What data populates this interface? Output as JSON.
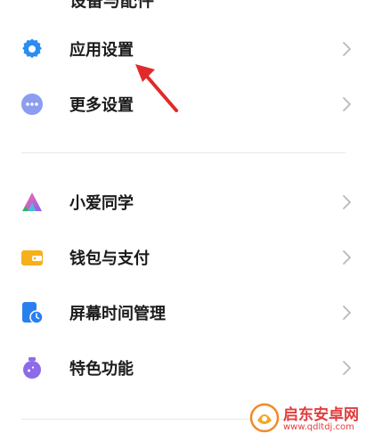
{
  "top_partial_label": "设备与配件",
  "section1": [
    {
      "label": "应用设置",
      "icon": "gear-icon",
      "color": "#2a8df5"
    },
    {
      "label": "更多设置",
      "icon": "more-dots-icon",
      "color": "#8c9cf0"
    }
  ],
  "section2": [
    {
      "label": "小爱同学",
      "icon": "xiaoai-icon"
    },
    {
      "label": "钱包与支付",
      "icon": "wallet-icon",
      "color": "#f6b01b"
    },
    {
      "label": "屏幕时间管理",
      "icon": "screen-time-icon",
      "color": "#2a7ff0"
    },
    {
      "label": "特色功能",
      "icon": "special-feature-icon",
      "color": "#8d6be8"
    }
  ],
  "watermark": {
    "name": "启东安卓网",
    "url": "www.qdltdj.com"
  },
  "colors": {
    "arrow": "#e12a2a",
    "chevron": "#b8b8b8"
  }
}
